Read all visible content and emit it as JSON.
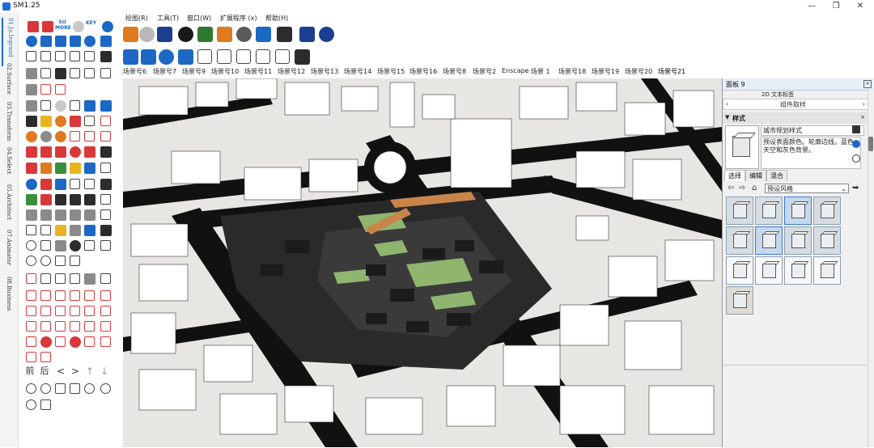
{
  "app": {
    "title": "SM1.25",
    "minimize": "—",
    "maximize": "❐",
    "close": "✕"
  },
  "side_tabs": [
    "01.Ju.Iegrand",
    "02.Surface",
    "03.Transform",
    "04.Select",
    "05.Architect",
    "07.Animator",
    "08.Business"
  ],
  "menu": [
    "绘图(R)",
    "工具(T)",
    "窗口(W)",
    "扩展程序 (x)",
    "帮助(H)"
  ],
  "scene_tabs": [
    "场景号6",
    "场景号7",
    "场景号9",
    "场景号10",
    "场景号11",
    "场景号12",
    "场景号13",
    "场景号14",
    "场景号15",
    "场景号16",
    "场景号8",
    "场景号2",
    "Enscape",
    "场景 1",
    "场景号18",
    "场景号19",
    "场景号20",
    "场景号21"
  ],
  "toolbar": {
    "su_more_top": "SU",
    "su_more_bottom": "MORE",
    "su_more_icons": [
      "+1",
      "sup",
      "MORE"
    ],
    "kbd_icon": "KEY"
  },
  "left_tools": {
    "front_label": "前",
    "back_label": "后",
    "left_arrow": "<",
    "right_arrow": ">",
    "up_arrow": "↑",
    "down_arrow": "↓"
  },
  "panel": {
    "title": "面板 9",
    "prev_line": "2D 文本标签",
    "component_bar": "组件取样",
    "section_title": "样式",
    "style_name": "城市规划样式",
    "style_description": "预设表面颜色。轮廓边线。蓝色天空和灰色背景。",
    "tabs": [
      "选择",
      "编辑",
      "混合"
    ],
    "select_value": "预设风格"
  },
  "colors": {
    "accent": "#1f6fd0",
    "road": "#111111",
    "building": "#ffffff",
    "green_space": "#8fb56e",
    "highlight_orange": "#c8854a"
  }
}
